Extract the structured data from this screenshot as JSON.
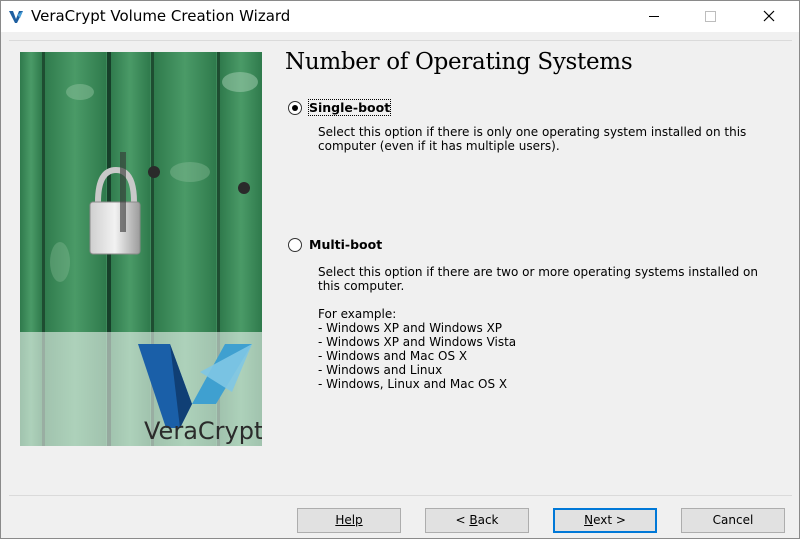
{
  "window": {
    "title": "VeraCrypt Volume Creation Wizard"
  },
  "banner": {
    "brand_name": "VeraCrypt"
  },
  "page": {
    "heading": "Number of Operating Systems"
  },
  "options": {
    "single_boot": {
      "label": "Single-boot",
      "selected": true,
      "description": "Select this option if there is only one operating system installed on this computer (even if it has multiple users)."
    },
    "multi_boot": {
      "label": "Multi-boot",
      "selected": false,
      "description": "Select this option if there are two or more operating systems installed on this computer.",
      "examples_title": "For example:",
      "examples": [
        "- Windows XP and Windows XP",
        "- Windows XP and Windows Vista",
        "- Windows and Mac OS X",
        "- Windows and Linux",
        "- Windows, Linux and Mac OS X"
      ]
    }
  },
  "buttons": {
    "help": "Help",
    "back_prefix": "< ",
    "back_accel": "B",
    "back_rest": "ack",
    "next_accel": "N",
    "next_rest": "ext >",
    "cancel": "Cancel"
  },
  "colors": {
    "focus_border": "#0078d7",
    "banner_green": "#3f8a5a",
    "logo_blue": "#1a5fa8"
  }
}
